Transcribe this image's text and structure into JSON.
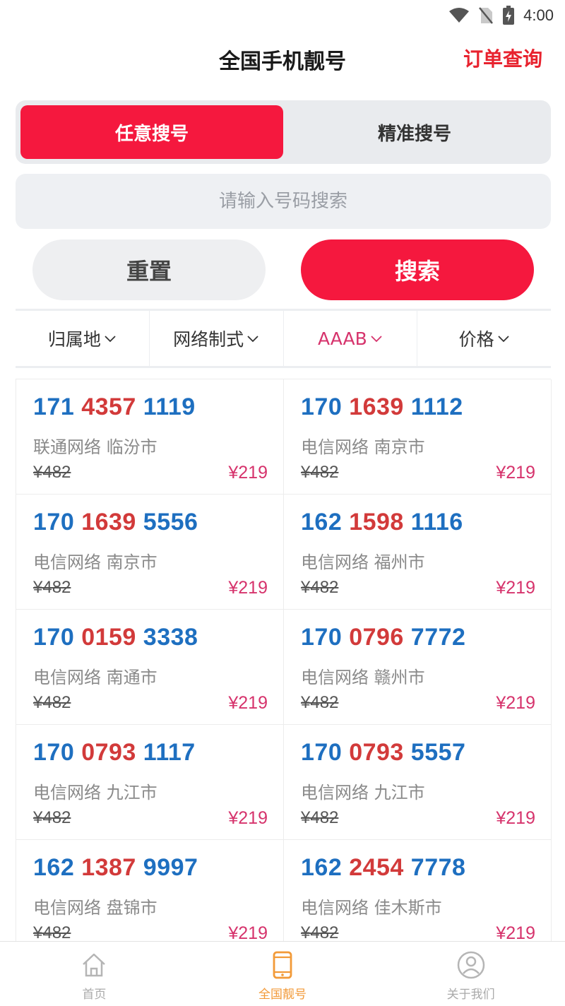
{
  "status": {
    "time": "4:00"
  },
  "header": {
    "title": "全国手机靓号",
    "order_link": "订单查询"
  },
  "segments": [
    {
      "label": "任意搜号",
      "active": true
    },
    {
      "label": "精准搜号",
      "active": false
    }
  ],
  "search": {
    "placeholder": "请输入号码搜索",
    "value": ""
  },
  "buttons": {
    "reset": "重置",
    "search": "搜索"
  },
  "filters": [
    {
      "label": "归属地",
      "active": false
    },
    {
      "label": "网络制式",
      "active": false
    },
    {
      "label": "AAAB",
      "active": true
    },
    {
      "label": "价格",
      "active": false
    }
  ],
  "numbers": [
    {
      "p1": "171",
      "p2": "4357",
      "p3": "1119",
      "location": "联通网络 临汾市",
      "original_price": "¥482",
      "price": "¥219"
    },
    {
      "p1": "170",
      "p2": "1639",
      "p3": "1112",
      "location": "电信网络 南京市",
      "original_price": "¥482",
      "price": "¥219"
    },
    {
      "p1": "170",
      "p2": "1639",
      "p3": "5556",
      "location": "电信网络 南京市",
      "original_price": "¥482",
      "price": "¥219"
    },
    {
      "p1": "162",
      "p2": "1598",
      "p3": "1116",
      "location": "电信网络 福州市",
      "original_price": "¥482",
      "price": "¥219"
    },
    {
      "p1": "170",
      "p2": "0159",
      "p3": "3338",
      "location": "电信网络 南通市",
      "original_price": "¥482",
      "price": "¥219"
    },
    {
      "p1": "170",
      "p2": "0796",
      "p3": "7772",
      "location": "电信网络 赣州市",
      "original_price": "¥482",
      "price": "¥219"
    },
    {
      "p1": "170",
      "p2": "0793",
      "p3": "1117",
      "location": "电信网络 九江市",
      "original_price": "¥482",
      "price": "¥219"
    },
    {
      "p1": "170",
      "p2": "0793",
      "p3": "5557",
      "location": "电信网络 九江市",
      "original_price": "¥482",
      "price": "¥219"
    },
    {
      "p1": "162",
      "p2": "1387",
      "p3": "9997",
      "location": "电信网络 盘锦市",
      "original_price": "¥482",
      "price": "¥219"
    },
    {
      "p1": "162",
      "p2": "2454",
      "p3": "7778",
      "location": "电信网络 佳木斯市",
      "original_price": "¥482",
      "price": "¥219"
    }
  ],
  "tabbar": [
    {
      "label": "首页",
      "icon": "home-icon",
      "active": false
    },
    {
      "label": "全国靓号",
      "icon": "phone-icon",
      "active": true
    },
    {
      "label": "关于我们",
      "icon": "user-icon",
      "active": false
    }
  ],
  "colors": {
    "accent": "#f5183e",
    "number_blue": "#1e6fc0",
    "number_red": "#d23a3a",
    "price": "#d6336c",
    "tab_active": "#f29a38"
  }
}
